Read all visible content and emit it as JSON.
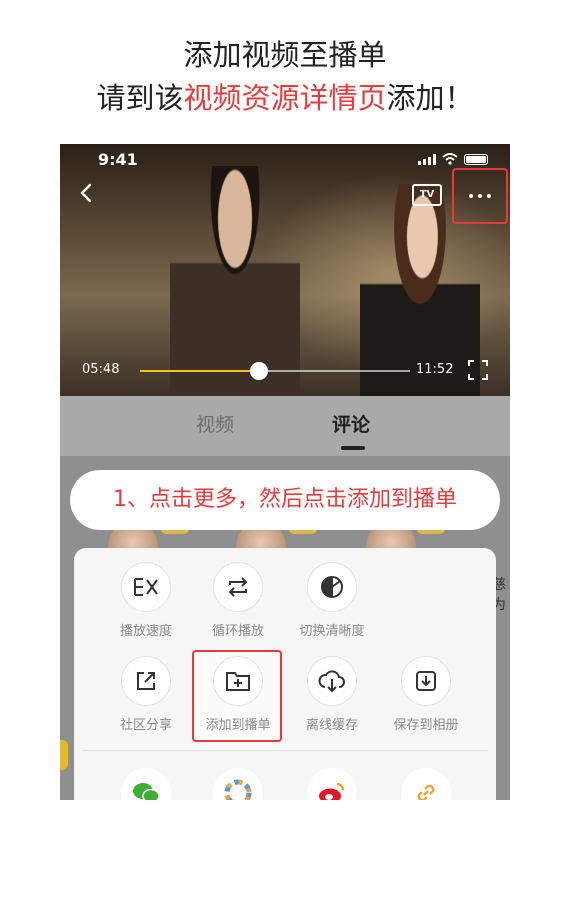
{
  "heading": {
    "line1": "添加视频至播单",
    "line2_prefix": "请到该",
    "line2_highlight": "视频资源详情页",
    "line2_suffix": "添加！"
  },
  "player": {
    "status_time": "9:41",
    "tv_label": "TV",
    "current_time": "05:48",
    "total_time": "11:52",
    "progress": 0.44
  },
  "tabs": [
    {
      "label": "视频",
      "active": false
    },
    {
      "label": "评论",
      "active": true
    }
  ],
  "instruction": "1、点击更多，然后点击添加到播单",
  "side_text": "慈为",
  "actions": {
    "row1": [
      {
        "label": "播放速度",
        "icon": "speed-icon"
      },
      {
        "label": "循环播放",
        "icon": "loop-icon"
      },
      {
        "label": "切换清晰度",
        "icon": "quality-icon"
      }
    ],
    "row2": [
      {
        "label": "社区分享",
        "icon": "share-icon"
      },
      {
        "label": "添加到播单",
        "icon": "add-to-playlist-icon"
      },
      {
        "label": "离线缓存",
        "icon": "cloud-download-icon"
      },
      {
        "label": "保存到相册",
        "icon": "save-to-album-icon"
      }
    ],
    "share_row": [
      {
        "icon": "wechat-icon"
      },
      {
        "icon": "moments-icon"
      },
      {
        "icon": "weibo-icon"
      },
      {
        "icon": "link-icon"
      }
    ]
  },
  "colors": {
    "highlight_red": "#e93b3b",
    "progress_yellow": "#f4c21b"
  }
}
